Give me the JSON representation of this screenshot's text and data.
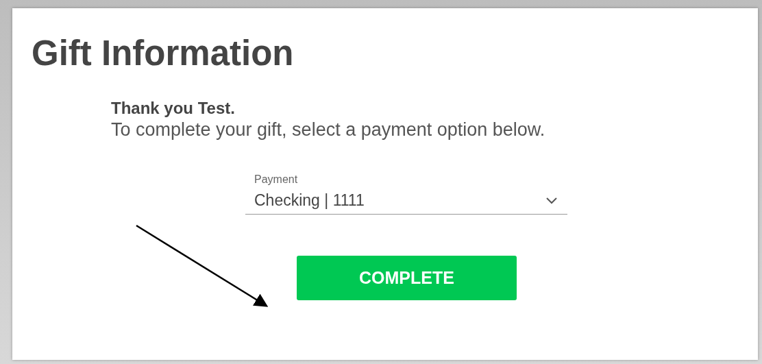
{
  "title": "Gift Information",
  "greeting": "Thank you Test.",
  "instruction": "To complete your gift, select a payment option below.",
  "payment": {
    "label": "Payment",
    "value": "Checking | 1111"
  },
  "button": {
    "label": "COMPLETE"
  }
}
